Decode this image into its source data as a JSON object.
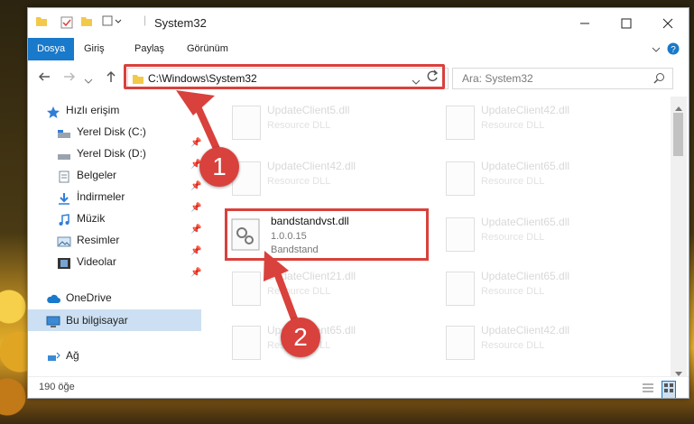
{
  "window": {
    "title": "System32"
  },
  "ribbon": {
    "tabs": [
      "Dosya",
      "Giriş",
      "Paylaş",
      "Görünüm"
    ]
  },
  "nav": {
    "address": "C:\\Windows\\System32",
    "search_placeholder": "Ara: System32"
  },
  "sidebar": {
    "items": [
      {
        "label": "Hızlı erişim",
        "icon": "star-icon"
      },
      {
        "label": "Yerel Disk (C:)",
        "icon": "drive-icon"
      },
      {
        "label": "Yerel Disk (D:)",
        "icon": "drive-icon"
      },
      {
        "label": "Belgeler",
        "icon": "documents-icon"
      },
      {
        "label": "İndirmeler",
        "icon": "download-icon"
      },
      {
        "label": "Müzik",
        "icon": "music-icon"
      },
      {
        "label": "Resimler",
        "icon": "pictures-icon"
      },
      {
        "label": "Videolar",
        "icon": "videos-icon"
      },
      {
        "label": "OneDrive",
        "icon": "cloud-icon"
      },
      {
        "label": "Bu bilgisayar",
        "icon": "computer-icon"
      },
      {
        "label": "Ağ",
        "icon": "network-icon"
      }
    ]
  },
  "files": [
    {
      "name": "UpdateClient5.dll",
      "type": "Resource DLL"
    },
    {
      "name": "UpdateClient42.dll",
      "type": "Resource DLL"
    },
    {
      "name": "UpdateClient42.dll",
      "type": "Resource DLL"
    },
    {
      "name": "UpdateClient65.dll",
      "type": "Resource DLL"
    },
    {
      "name": "UpdateClient65.dll",
      "type": "Resource DLL"
    },
    {
      "name": "UpdateClient21.dll",
      "type": "Resource DLL"
    },
    {
      "name": "UpdateClient65.dll",
      "type": "Resource DLL"
    },
    {
      "name": "UpdateClient65.dll",
      "type": "Resource DLL"
    },
    {
      "name": "UpdateClient42.dll",
      "type": "Resource DLL"
    }
  ],
  "highlighted_file": {
    "name": "bandstandvst.dll",
    "version": "1.0.0.15",
    "company": "Bandstand"
  },
  "status": {
    "count": "190 öğe"
  },
  "annotations": {
    "badge1": "1",
    "badge2": "2"
  },
  "colors": {
    "accent": "#1979ca",
    "highlight": "#d9413c"
  }
}
